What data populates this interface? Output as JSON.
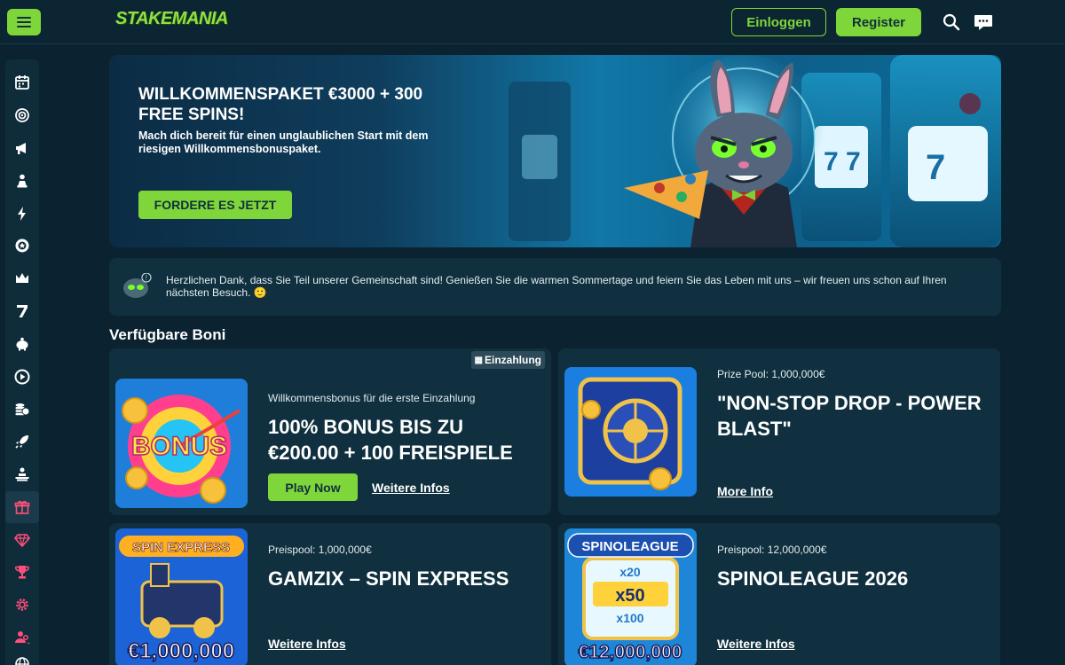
{
  "header": {
    "logo_text": "STAKEMANIA",
    "login_label": "Einloggen",
    "register_label": "Register"
  },
  "hero": {
    "title": "WILLKOMMENSPAKET €3000 + 300 FREE SPINS!",
    "subtitle": "Mach dich bereit für einen unglaublichen Start mit dem riesigen Willkommensbonuspaket.",
    "cta_label": "FORDERE ES JETZT"
  },
  "notice": {
    "text": "Herzlichen Dank, dass Sie Teil unserer Gemeinschaft sind! Genießen Sie die warmen Sommertage und feiern Sie das Leben mit uns – wir freuen uns schon auf Ihren nächsten Besuch. 🙂"
  },
  "bonuses": {
    "section_title": "Verfügbare Boni",
    "cards": [
      {
        "badge": "Einzahlung",
        "kicker": "Willkommensbonus für die erste Einzahlung",
        "title": "100% BONUS BIS ZU €200.00 + 100 FREISPIELE",
        "play_label": "Play Now",
        "link_label": "Weitere Infos",
        "image_text": "BONUS"
      },
      {
        "kicker": "Prize Pool: 1,000,000€",
        "title": "\"NON-STOP DROP - POWER BLAST\"",
        "link_label": "More Info"
      },
      {
        "kicker": "Preispool: 1,000,000€",
        "title": "GAMZIX – SPIN EXPRESS",
        "link_label": "Weitere Infos",
        "image_top": "SPIN EXPRESS",
        "image_amount": "€1,000,000"
      },
      {
        "kicker": "Preispool: 12,000,000€",
        "title": "SPINOLEAGUE 2026",
        "link_label": "Weitere Infos",
        "image_top": "SPINOLEAGUE",
        "image_multipliers": [
          "x20",
          "x50",
          "x100"
        ],
        "image_amount": "€12,000,000"
      }
    ]
  },
  "sidebar": {
    "icons": [
      "calendar-icon",
      "target-icon",
      "megaphone-icon",
      "chess-pawn-icon",
      "lightning-icon",
      "chip-icon",
      "crown-icon",
      "seven-icon",
      "piggy-bank-icon",
      "play-icon",
      "coins-icon",
      "rocket-icon",
      "casino-dealer-icon",
      "gift-icon",
      "diamond-icon",
      "trophy-icon",
      "settings-icon",
      "users-icon",
      "globe-icon"
    ]
  },
  "colors": {
    "accent": "#7fd63a",
    "background": "#0b2330",
    "card": "#10303f"
  }
}
